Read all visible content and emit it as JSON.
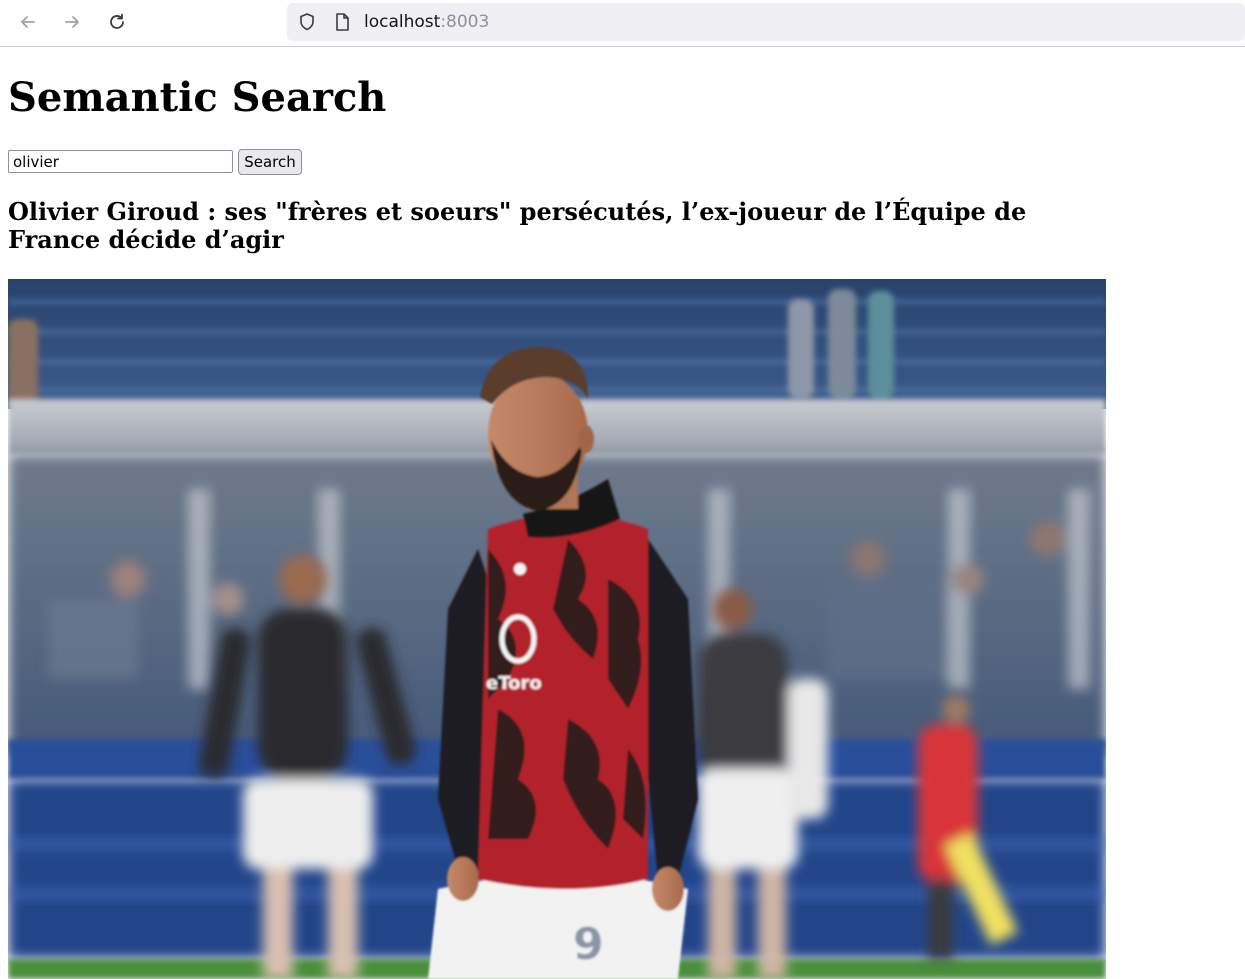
{
  "browser": {
    "url_host": "localhost",
    "url_port": ":8003"
  },
  "page": {
    "title": "Semantic Search"
  },
  "search": {
    "value": "olivier",
    "button_label": "Search"
  },
  "results": [
    {
      "title": "Olivier Giroud : ses \"frères et soeurs\" persécutés, l’ex-joueur de l’Équipe de France décide d’agir",
      "image_jersey_number": "9",
      "image_sponsor_text": "eToro"
    }
  ],
  "colors": {
    "jersey_red": "#b3232c",
    "jersey_black": "#1b1b1d",
    "stand_blue": "#2f4d7a",
    "pitch_green": "#4a8f3a"
  }
}
